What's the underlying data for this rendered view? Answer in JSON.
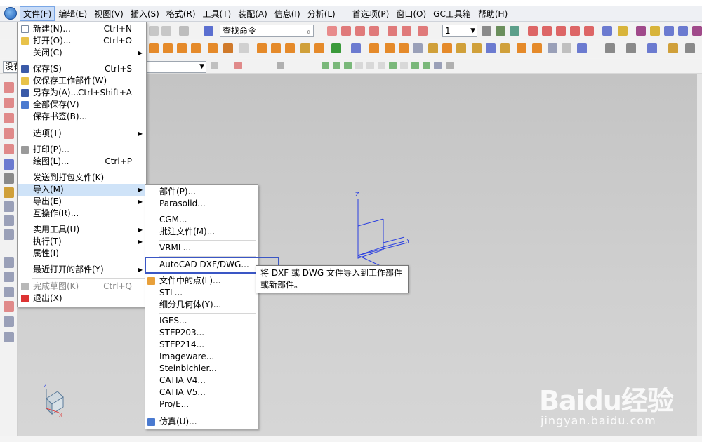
{
  "menubar": {
    "items": [
      "文件(F)",
      "编辑(E)",
      "视图(V)",
      "插入(S)",
      "格式(R)",
      "工具(T)",
      "装配(A)",
      "信息(I)",
      "分析(L)",
      "首选项(P)",
      "窗口(O)",
      "GC工具箱",
      "帮助(H)"
    ]
  },
  "toolbar": {
    "search_placeholder": "查找命令",
    "number_value": "1",
    "filter_value": "没有"
  },
  "file_menu": {
    "items": [
      {
        "label": "新建(N)...",
        "shortcut": "Ctrl+N"
      },
      {
        "label": "打开(O)...",
        "shortcut": "Ctrl+O"
      },
      {
        "label": "关闭(C)",
        "shortcut": ""
      },
      {
        "label": "保存(S)",
        "shortcut": "Ctrl+S"
      },
      {
        "label": "仅保存工作部件(W)",
        "shortcut": ""
      },
      {
        "label": "另存为(A)...",
        "shortcut": "Ctrl+Shift+A"
      },
      {
        "label": "全部保存(V)",
        "shortcut": ""
      },
      {
        "label": "保存书签(B)...",
        "shortcut": ""
      },
      {
        "label": "选项(T)",
        "shortcut": ""
      },
      {
        "label": "打印(P)...",
        "shortcut": ""
      },
      {
        "label": "绘图(L)...",
        "shortcut": "Ctrl+P"
      },
      {
        "label": "发送到打包文件(K)",
        "shortcut": ""
      },
      {
        "label": "导入(M)",
        "shortcut": ""
      },
      {
        "label": "导出(E)",
        "shortcut": ""
      },
      {
        "label": "互操作(R)...",
        "shortcut": ""
      },
      {
        "label": "实用工具(U)",
        "shortcut": ""
      },
      {
        "label": "执行(T)",
        "shortcut": ""
      },
      {
        "label": "属性(I)",
        "shortcut": ""
      },
      {
        "label": "最近打开的部件(Y)",
        "shortcut": ""
      },
      {
        "label": "完成草图(K)",
        "shortcut": "Ctrl+Q"
      },
      {
        "label": "退出(X)",
        "shortcut": ""
      }
    ]
  },
  "import_menu": {
    "items": [
      "部件(P)...",
      "Parasolid...",
      "CGM...",
      "批注文件(M)...",
      "VRML...",
      "AutoCAD DXF/DWG...",
      "文件中的点(L)...",
      "STL...",
      "细分几何体(Y)...",
      "IGES...",
      "STEP203...",
      "STEP214...",
      "Imageware...",
      "Steinbichler...",
      "CATIA V4...",
      "CATIA V5...",
      "Pro/E...",
      "仿真(U)..."
    ]
  },
  "tooltip": {
    "line1": "将 DXF 或 DWG 文件导入到工作部件",
    "line2": "或新部件。"
  },
  "viewport": {
    "axis_x": "X",
    "axis_y": "Y",
    "axis_z": "Z"
  },
  "watermark": {
    "main": "Baidu经验",
    "sub": "jingyan.baidu.com"
  },
  "colors": {
    "accent_blue": "#3a56c5",
    "menu_highlight": "#cfe3f8",
    "datum_blue": "#2a3fe0"
  }
}
